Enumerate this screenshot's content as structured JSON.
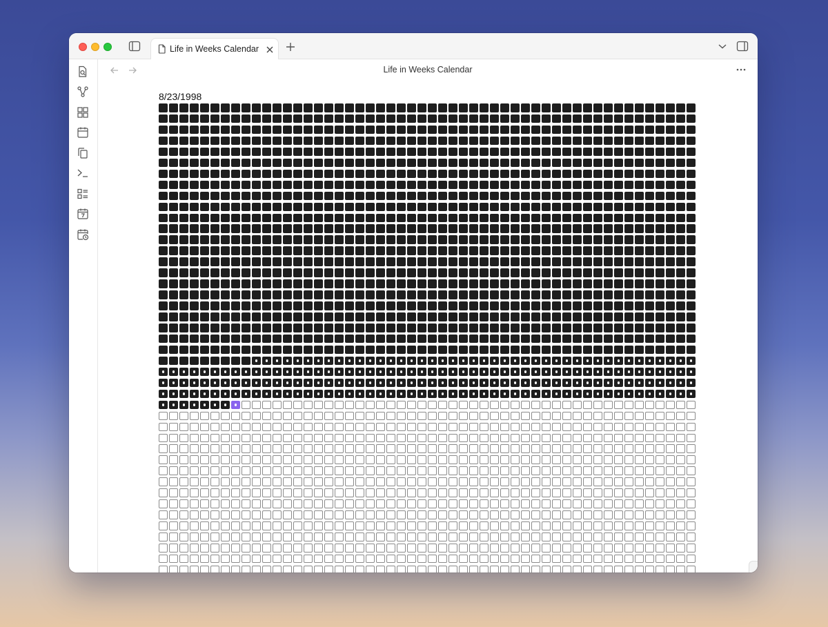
{
  "window": {
    "tab_title": "Life in Weeks Calendar",
    "view_title": "Life in Weeks Calendar"
  },
  "ribbon": {
    "icons": [
      "search-file-icon",
      "graph-icon",
      "dashboard-icon",
      "calendar-icon",
      "copy-icon",
      "terminal-icon",
      "list-icon",
      "calendar-seven-icon",
      "calendar-clock-icon"
    ]
  },
  "calendar": {
    "start_date": "8/23/1998",
    "weeks_per_row": 52,
    "visible_rows": 43,
    "solid_rows": 23,
    "dotted_start_index": 1205,
    "current_week_index": 1411,
    "colors": {
      "past": "#1e1e1e",
      "future": "#ffffff",
      "current": "#8a63ee"
    }
  }
}
